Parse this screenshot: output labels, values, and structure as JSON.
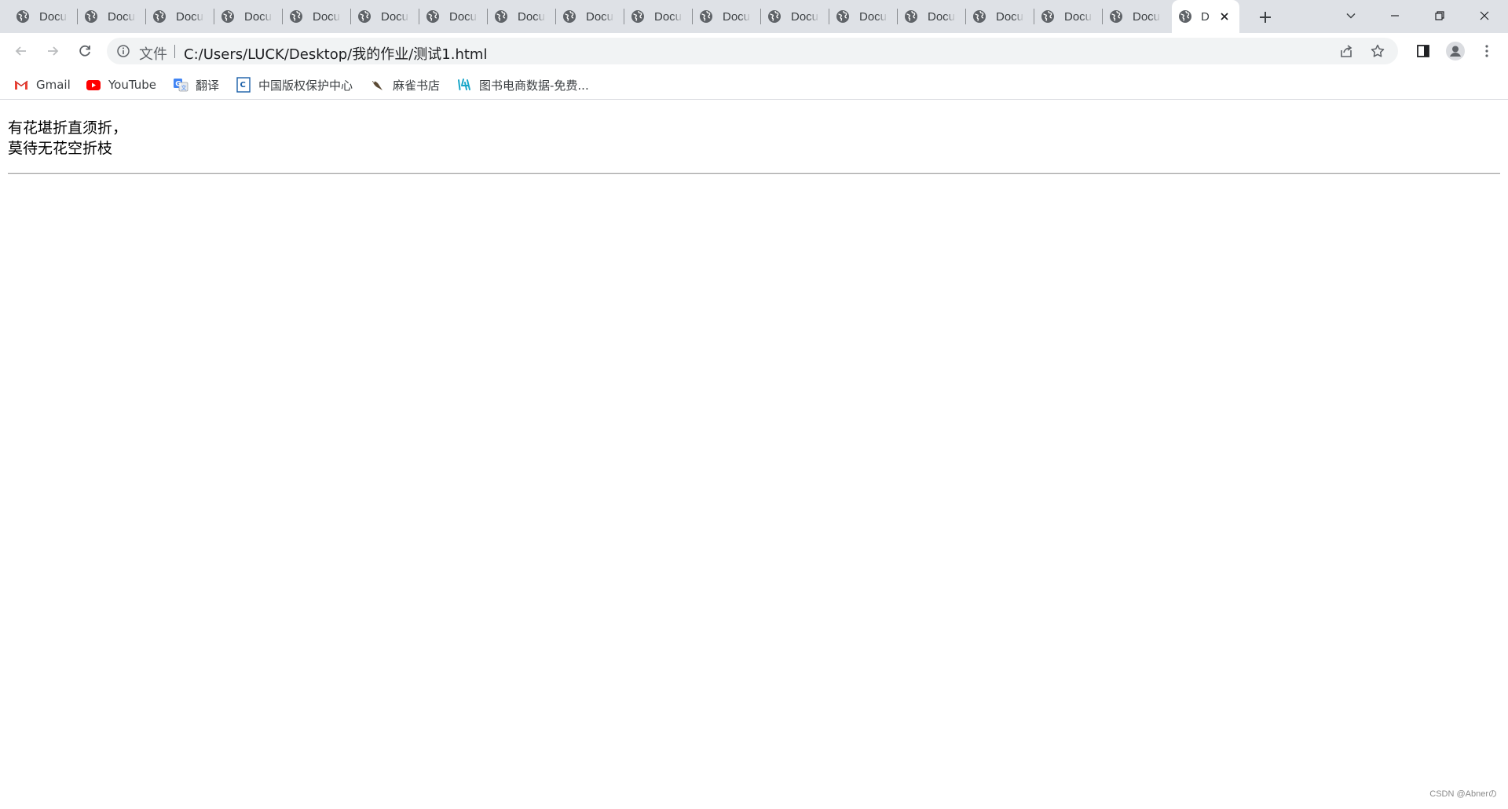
{
  "tabs": [
    {
      "title": "Docu"
    },
    {
      "title": "Docu"
    },
    {
      "title": "Docu"
    },
    {
      "title": "Docu"
    },
    {
      "title": "Docu"
    },
    {
      "title": "Docu"
    },
    {
      "title": "Docu"
    },
    {
      "title": "Docu"
    },
    {
      "title": "Docu"
    },
    {
      "title": "Docu"
    },
    {
      "title": "Docu"
    },
    {
      "title": "Docu"
    },
    {
      "title": "Docu"
    },
    {
      "title": "Docu"
    },
    {
      "title": "Docu"
    },
    {
      "title": "Docu"
    },
    {
      "title": "Docu"
    }
  ],
  "active_tab": {
    "title": "D"
  },
  "icons": {
    "tab_favicon": "globe-icon",
    "tab_close": "close-icon",
    "new_tab": "plus-icon",
    "tab_search": "chevron-down-icon",
    "minimize": "minimize-icon",
    "restore": "restore-icon",
    "close_window": "close-icon",
    "back": "arrow-left-icon",
    "forward": "arrow-right-icon",
    "reload": "reload-icon",
    "site_info": "info-icon",
    "share": "share-icon",
    "bookmark": "star-icon",
    "side_panel": "side-panel-icon",
    "profile": "avatar-icon",
    "menu": "kebab-menu-icon"
  },
  "omnibox": {
    "chip": "文件",
    "url": "C:/Users/LUCK/Desktop/我的作业/测试1.html"
  },
  "bookmarks": [
    {
      "label": "Gmail",
      "icon": "gmail-icon"
    },
    {
      "label": "YouTube",
      "icon": "youtube-icon"
    },
    {
      "label": "翻译",
      "icon": "translate-icon"
    },
    {
      "label": "中国版权保护中心",
      "icon": "copyright-center-icon"
    },
    {
      "label": "麻雀书店",
      "icon": "sparrow-icon"
    },
    {
      "label": "图书电商数据-免费...",
      "icon": "book-data-icon"
    }
  ],
  "page": {
    "line1": "有花堪折直须折，",
    "line2": "莫待无花空折枝"
  },
  "watermark": "CSDN @Abnerの",
  "colors": {
    "tabstrip": "#dee1e6",
    "omnibox": "#f1f3f4",
    "youtube_red": "#ff0000",
    "gmail_red": "#ea4335",
    "translate_blue": "#4285f4"
  }
}
